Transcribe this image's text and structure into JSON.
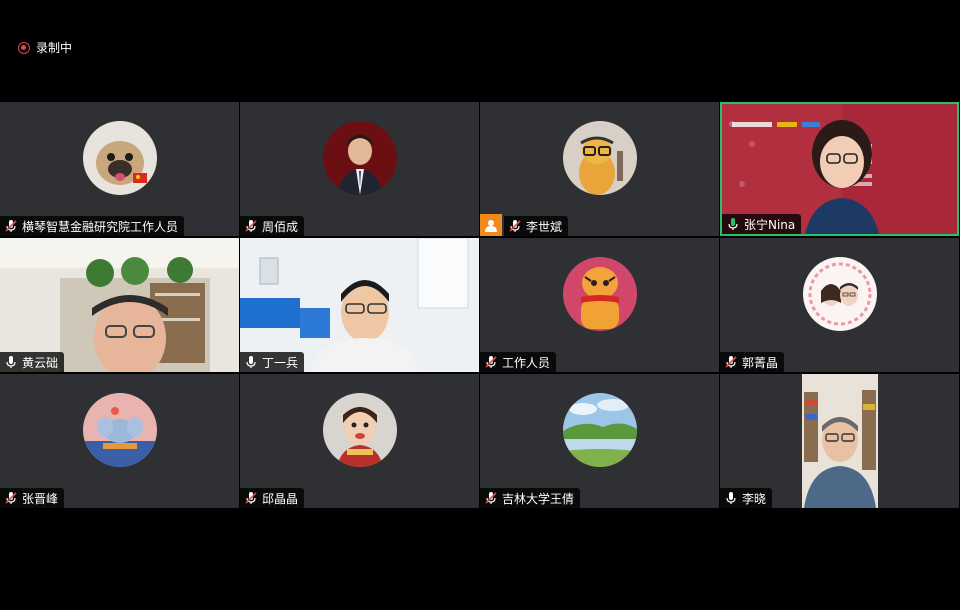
{
  "recording": {
    "label": "录制中"
  },
  "participants": [
    {
      "name": "横琴智慧金融研究院工作人员",
      "mic": "muted"
    },
    {
      "name": "周佰成",
      "mic": "muted"
    },
    {
      "name": "李世斌",
      "mic": "muted"
    },
    {
      "name": "张宁Nina",
      "mic": "active"
    },
    {
      "name": "黄云础",
      "mic": "on"
    },
    {
      "name": "丁一兵",
      "mic": "on"
    },
    {
      "name": "工作人员",
      "mic": "muted"
    },
    {
      "name": "郭菁晶",
      "mic": "muted"
    },
    {
      "name": "张晋峰",
      "mic": "muted"
    },
    {
      "name": "邱晶晶",
      "mic": "muted"
    },
    {
      "name": "吉林大学王倩",
      "mic": "muted"
    },
    {
      "name": "李晓",
      "mic": "on"
    }
  ],
  "colors": {
    "active_border": "#27c26b",
    "tile_bg": "#2f3033",
    "record_red": "#e04848"
  }
}
